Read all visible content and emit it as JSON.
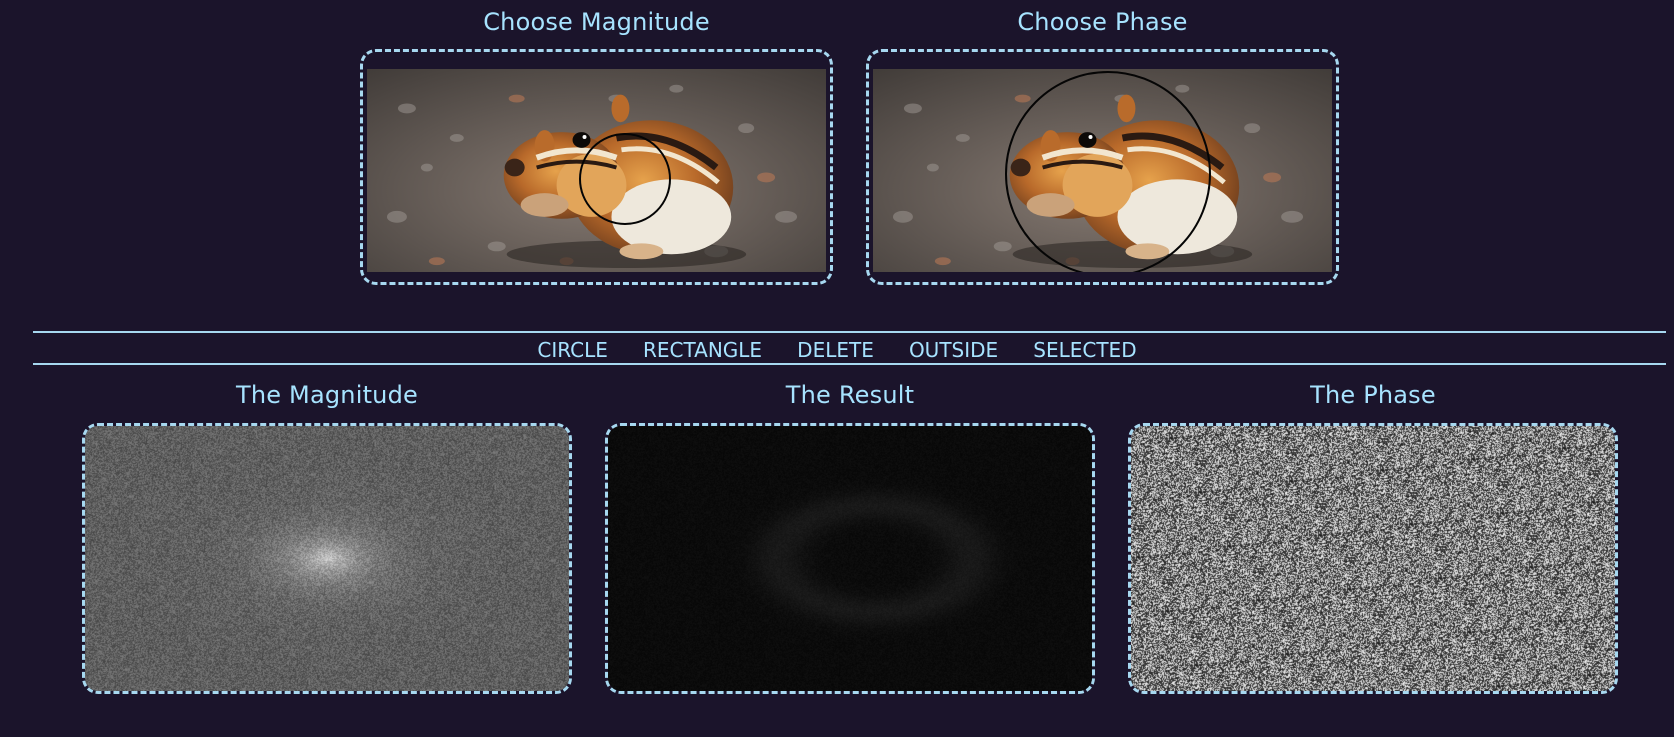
{
  "top": {
    "magnitude_title": "Choose Magnitude",
    "phase_title": "Choose Phase"
  },
  "toolbar": {
    "items": [
      "CIRCLE",
      "RECTANGLE",
      "DELETE",
      "OUTSIDE",
      "SELECTED"
    ]
  },
  "bottom": {
    "magnitude_title": "The Magnitude",
    "result_title": "The Result",
    "phase_title": "The Phase"
  },
  "colors": {
    "background": "#1b142b",
    "accent": "#a7e3ff",
    "border": "#a7d8f0"
  },
  "icons": {
    "selection_shape": "circle-selection"
  }
}
